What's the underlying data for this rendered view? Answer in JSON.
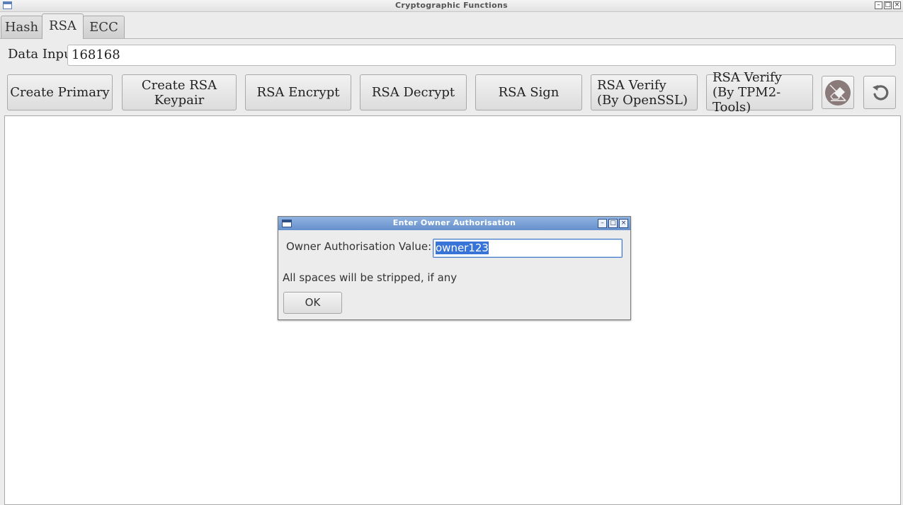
{
  "window": {
    "title": "Cryptographic Functions",
    "controls": {
      "minimize": "–",
      "maximize": "□",
      "close": "×"
    }
  },
  "tabs": [
    {
      "label": "Hash",
      "active": false
    },
    {
      "label": "RSA",
      "active": true
    },
    {
      "label": "ECC",
      "active": false
    }
  ],
  "data_input": {
    "label": "Data Input:",
    "value": "168168"
  },
  "toolbar": {
    "create_primary": "Create Primary",
    "create_rsa_keypair": "Create RSA Keypair",
    "rsa_encrypt": "RSA Encrypt",
    "rsa_decrypt": "RSA Decrypt",
    "rsa_sign": "RSA Sign",
    "rsa_verify_openssl_line1": "RSA Verify",
    "rsa_verify_openssl_line2": "(By OpenSSL)",
    "rsa_verify_tpm_line1": "RSA Verify",
    "rsa_verify_tpm_line2": "(By TPM2-Tools)",
    "icons": {
      "clear": "eraser-icon",
      "reset": "undo-icon"
    }
  },
  "output": {
    "text": ""
  },
  "dialog": {
    "title": "Enter Owner Authorisation",
    "field_label": "Owner Authorisation Value:",
    "field_value": "owner123",
    "note": "All spaces will be stripped, if any",
    "ok_label": "OK"
  },
  "colors": {
    "dialog_titlebar": "#6f96d0",
    "selection": "#3874d8",
    "background": "#ececec"
  }
}
